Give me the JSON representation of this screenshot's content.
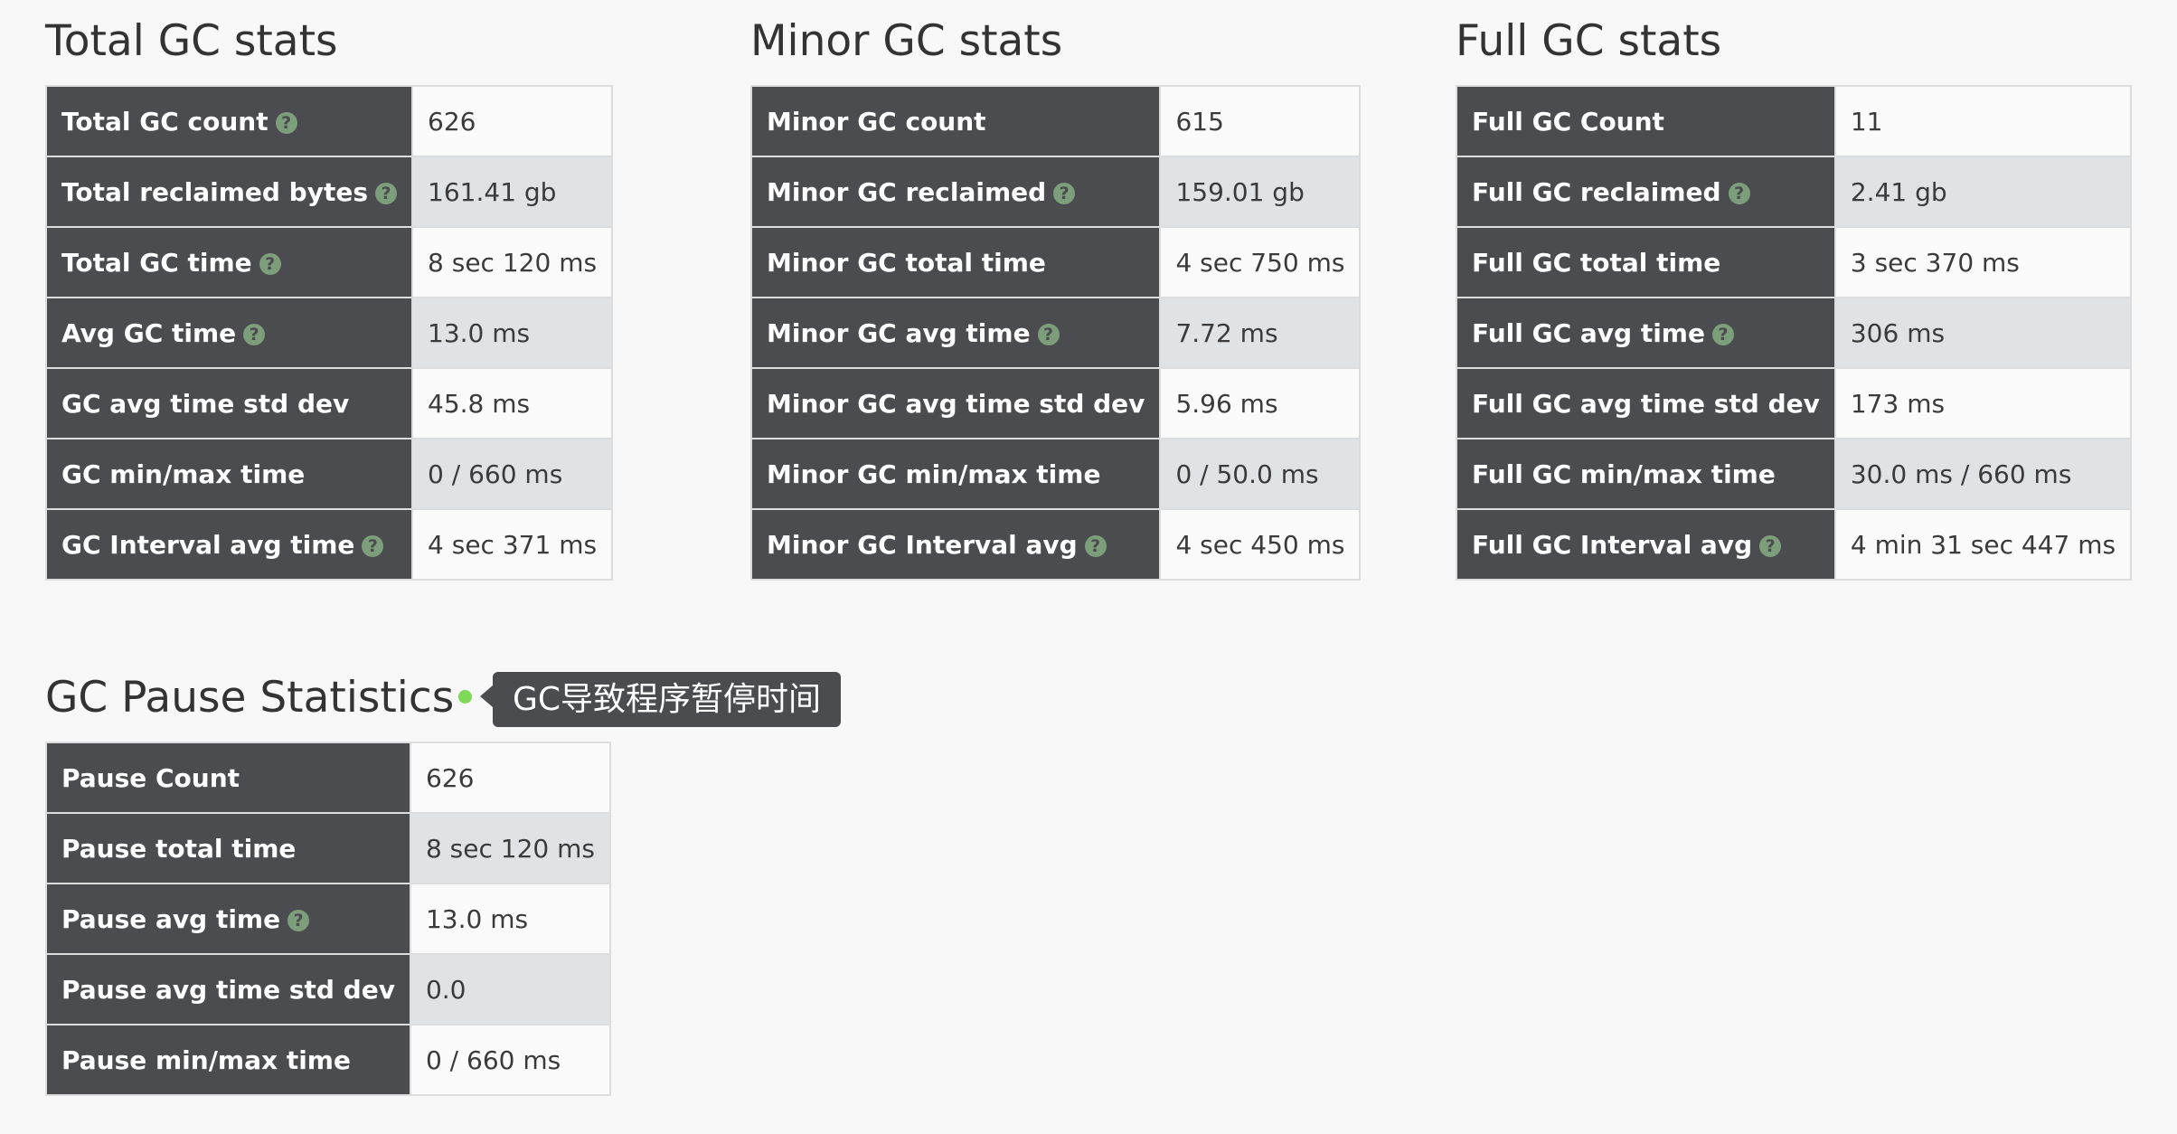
{
  "total_gc": {
    "title": "Total GC stats",
    "rows": [
      {
        "label": "Total GC count",
        "value": "626",
        "help": true
      },
      {
        "label": "Total reclaimed bytes",
        "value": "161.41 gb",
        "help": true
      },
      {
        "label": "Total GC time",
        "value": "8 sec 120 ms",
        "help": true
      },
      {
        "label": "Avg GC time",
        "value": "13.0 ms",
        "help": true
      },
      {
        "label": "GC avg time std dev",
        "value": "45.8 ms",
        "help": false
      },
      {
        "label": "GC min/max time",
        "value": "0 / 660 ms",
        "help": false
      },
      {
        "label": "GC Interval avg time",
        "value": "4 sec 371 ms",
        "help": true
      }
    ]
  },
  "minor_gc": {
    "title": "Minor GC stats",
    "rows": [
      {
        "label": "Minor GC count",
        "value": "615",
        "help": false
      },
      {
        "label": "Minor GC reclaimed",
        "value": "159.01 gb",
        "help": true
      },
      {
        "label": "Minor GC total time",
        "value": "4 sec 750 ms",
        "help": false
      },
      {
        "label": "Minor GC avg time",
        "value": "7.72 ms",
        "help": true
      },
      {
        "label": "Minor GC avg time std dev",
        "value": "5.96 ms",
        "help": false
      },
      {
        "label": "Minor GC min/max time",
        "value": "0 / 50.0 ms",
        "help": false
      },
      {
        "label": "Minor GC Interval avg",
        "value": "4 sec 450 ms",
        "help": true
      }
    ]
  },
  "full_gc": {
    "title": "Full GC stats",
    "rows": [
      {
        "label": "Full GC Count",
        "value": "11",
        "help": false
      },
      {
        "label": "Full GC reclaimed",
        "value": "2.41 gb",
        "help": true
      },
      {
        "label": "Full GC total time",
        "value": "3 sec 370 ms",
        "help": false
      },
      {
        "label": "Full GC avg time",
        "value": "306 ms",
        "help": true
      },
      {
        "label": "Full GC avg time std dev",
        "value": "173 ms",
        "help": false
      },
      {
        "label": "Full GC min/max time",
        "value": "30.0 ms / 660 ms",
        "help": false
      },
      {
        "label": "Full GC Interval avg",
        "value": "4 min 31 sec 447 ms",
        "help": true
      }
    ]
  },
  "gc_pause": {
    "title": "GC Pause Statistics",
    "tooltip": "GC导致程序暂停时间",
    "rows": [
      {
        "label": "Pause Count",
        "value": "626",
        "help": false
      },
      {
        "label": "Pause total time",
        "value": "8 sec 120 ms",
        "help": false
      },
      {
        "label": "Pause avg time",
        "value": "13.0 ms",
        "help": true
      },
      {
        "label": "Pause avg time std dev",
        "value": "0.0",
        "help": false
      },
      {
        "label": "Pause min/max time",
        "value": "0 / 660 ms",
        "help": false
      }
    ]
  },
  "help_icon_glyph": "?",
  "colors": {
    "label_bg": "#4b4c4f",
    "row_alt_bg": "#dfe3e5",
    "help_icon": "#7d9e7b",
    "status_dot": "#7ed957"
  }
}
